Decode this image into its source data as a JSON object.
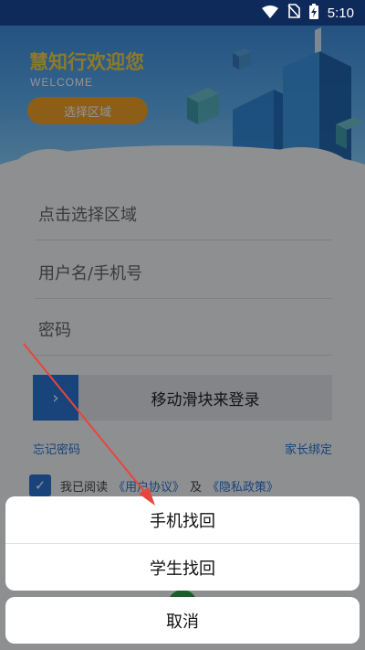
{
  "status_bar": {
    "time": "5:10",
    "icons": [
      "wifi-icon",
      "no-sim-icon",
      "battery-charging-icon"
    ]
  },
  "header": {
    "title": "慧知行欢迎您",
    "subtitle": "WELCOME",
    "region_button": "选择区域"
  },
  "form": {
    "region_placeholder": "点击选择区域",
    "username_placeholder": "用户名/手机号",
    "password_placeholder": "密码",
    "slider_label": "移动滑块来登录",
    "slider_knob_icon": "chevron-right-icon",
    "forgot_password": "忘记密码",
    "parent_binding": "家长绑定",
    "agree_prefix": "我已阅读",
    "user_agreement": "《用户协议》",
    "agree_and": "及",
    "privacy_policy": "《隐私政策》",
    "agree_checked": true
  },
  "action_sheet": {
    "options": [
      "手机找回",
      "学生找回"
    ],
    "cancel": "取消"
  },
  "colors": {
    "accent": "#2b74d4",
    "region_button": "#f2a32a",
    "title": "#f3d24a",
    "arrow": "#e8453c"
  }
}
